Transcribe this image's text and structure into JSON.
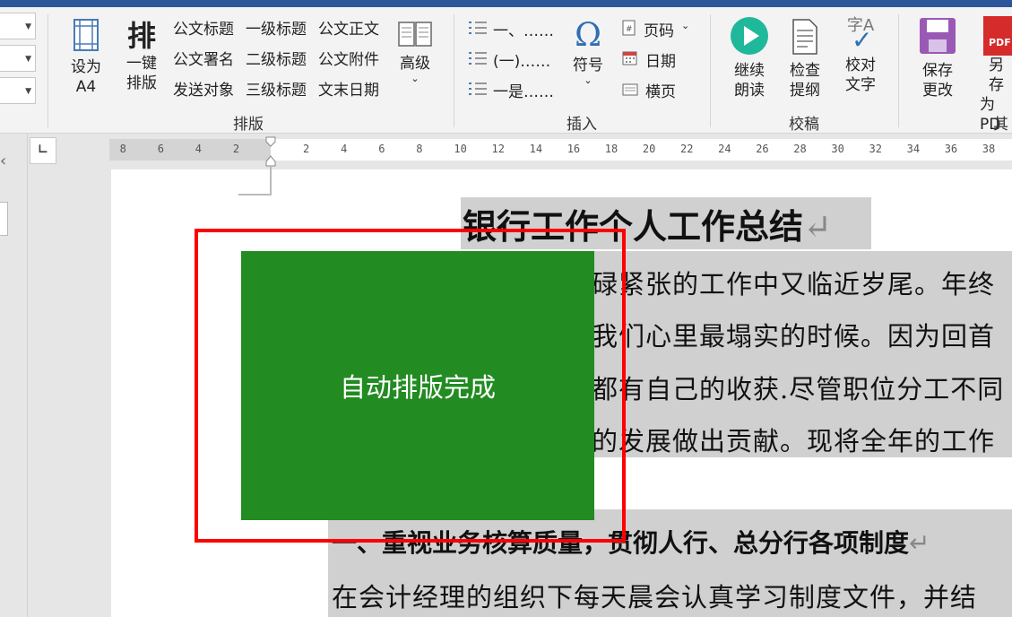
{
  "ribbon": {
    "paiban_group": {
      "label": "排版",
      "set_a4": [
        "设为",
        "A4"
      ],
      "one_click_icon": "排",
      "one_click": [
        "一键",
        "排版"
      ],
      "items": [
        [
          "公文标题",
          "一级标题",
          "公文正文"
        ],
        [
          "公文署名",
          "二级标题",
          "公文附件"
        ],
        [
          "发送对象",
          "三级标题",
          "文末日期"
        ]
      ],
      "advanced": "高级"
    },
    "insert_group": {
      "label": "插入",
      "lists": [
        "一、……",
        "(一)……",
        "一是……"
      ],
      "symbol": "符号",
      "page_number": "页码",
      "date": "日期",
      "landscape": "横页"
    },
    "proof_group": {
      "label": "校稿",
      "continue_read": [
        "继续",
        "朗读"
      ],
      "check_outline": [
        "检查",
        "提纲"
      ],
      "proof_text": [
        "校对",
        "文字"
      ],
      "proof_icon_text": "字A"
    },
    "other_group": {
      "label": "其",
      "save_changes": [
        "保存",
        "更改"
      ],
      "save_as_pdf": [
        "另存",
        "为PD"
      ],
      "pdf_icon_text": "PDF"
    }
  },
  "ruler": {
    "tabstop_symbol": "∟",
    "left_ticks": [
      "8",
      "6",
      "4",
      "2"
    ],
    "right_ticks": [
      "2",
      "4",
      "6",
      "8",
      "10",
      "12",
      "14",
      "16",
      "18",
      "20",
      "22",
      "24",
      "26",
      "28",
      "30",
      "32",
      "34",
      "36",
      "38"
    ]
  },
  "document": {
    "title": "银行工作个人工作总结",
    "para_mark": "↵",
    "lines": [
      "碌紧张的工作中又临近岁尾。年终",
      "我们心里最塌实的时候。因为回首",
      "都有自己的收获.尽管职位分工不同",
      "的发展做出贡献。现将全年的工作"
    ],
    "heading": "一、重视业务核算质量，贯彻人行、总分行各项制度",
    "last_line": "在会计经理的组织下每天晨会认真学习制度文件，并结"
  },
  "overlay": {
    "message": "自动排版完成"
  },
  "colors": {
    "overlay_bg": "#228b22",
    "highlight_box": "#ff0000",
    "title_bar": "#2b579a"
  }
}
